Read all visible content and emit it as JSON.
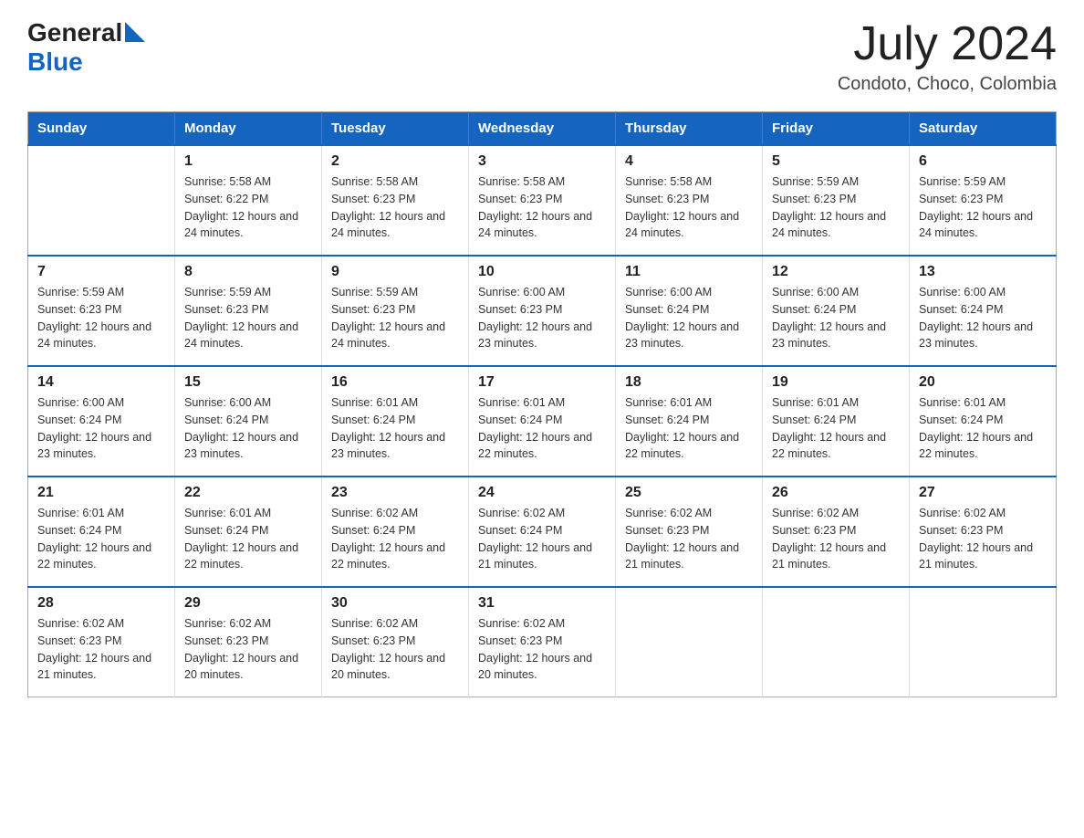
{
  "logo": {
    "text_general": "General",
    "text_blue": "Blue",
    "triangle_char": "▶"
  },
  "title": "July 2024",
  "subtitle": "Condoto, Choco, Colombia",
  "days_of_week": [
    "Sunday",
    "Monday",
    "Tuesday",
    "Wednesday",
    "Thursday",
    "Friday",
    "Saturday"
  ],
  "weeks": [
    [
      {
        "day": "",
        "sunrise": "",
        "sunset": "",
        "daylight": ""
      },
      {
        "day": "1",
        "sunrise": "Sunrise: 5:58 AM",
        "sunset": "Sunset: 6:22 PM",
        "daylight": "Daylight: 12 hours and 24 minutes."
      },
      {
        "day": "2",
        "sunrise": "Sunrise: 5:58 AM",
        "sunset": "Sunset: 6:23 PM",
        "daylight": "Daylight: 12 hours and 24 minutes."
      },
      {
        "day": "3",
        "sunrise": "Sunrise: 5:58 AM",
        "sunset": "Sunset: 6:23 PM",
        "daylight": "Daylight: 12 hours and 24 minutes."
      },
      {
        "day": "4",
        "sunrise": "Sunrise: 5:58 AM",
        "sunset": "Sunset: 6:23 PM",
        "daylight": "Daylight: 12 hours and 24 minutes."
      },
      {
        "day": "5",
        "sunrise": "Sunrise: 5:59 AM",
        "sunset": "Sunset: 6:23 PM",
        "daylight": "Daylight: 12 hours and 24 minutes."
      },
      {
        "day": "6",
        "sunrise": "Sunrise: 5:59 AM",
        "sunset": "Sunset: 6:23 PM",
        "daylight": "Daylight: 12 hours and 24 minutes."
      }
    ],
    [
      {
        "day": "7",
        "sunrise": "Sunrise: 5:59 AM",
        "sunset": "Sunset: 6:23 PM",
        "daylight": "Daylight: 12 hours and 24 minutes."
      },
      {
        "day": "8",
        "sunrise": "Sunrise: 5:59 AM",
        "sunset": "Sunset: 6:23 PM",
        "daylight": "Daylight: 12 hours and 24 minutes."
      },
      {
        "day": "9",
        "sunrise": "Sunrise: 5:59 AM",
        "sunset": "Sunset: 6:23 PM",
        "daylight": "Daylight: 12 hours and 24 minutes."
      },
      {
        "day": "10",
        "sunrise": "Sunrise: 6:00 AM",
        "sunset": "Sunset: 6:23 PM",
        "daylight": "Daylight: 12 hours and 23 minutes."
      },
      {
        "day": "11",
        "sunrise": "Sunrise: 6:00 AM",
        "sunset": "Sunset: 6:24 PM",
        "daylight": "Daylight: 12 hours and 23 minutes."
      },
      {
        "day": "12",
        "sunrise": "Sunrise: 6:00 AM",
        "sunset": "Sunset: 6:24 PM",
        "daylight": "Daylight: 12 hours and 23 minutes."
      },
      {
        "day": "13",
        "sunrise": "Sunrise: 6:00 AM",
        "sunset": "Sunset: 6:24 PM",
        "daylight": "Daylight: 12 hours and 23 minutes."
      }
    ],
    [
      {
        "day": "14",
        "sunrise": "Sunrise: 6:00 AM",
        "sunset": "Sunset: 6:24 PM",
        "daylight": "Daylight: 12 hours and 23 minutes."
      },
      {
        "day": "15",
        "sunrise": "Sunrise: 6:00 AM",
        "sunset": "Sunset: 6:24 PM",
        "daylight": "Daylight: 12 hours and 23 minutes."
      },
      {
        "day": "16",
        "sunrise": "Sunrise: 6:01 AM",
        "sunset": "Sunset: 6:24 PM",
        "daylight": "Daylight: 12 hours and 23 minutes."
      },
      {
        "day": "17",
        "sunrise": "Sunrise: 6:01 AM",
        "sunset": "Sunset: 6:24 PM",
        "daylight": "Daylight: 12 hours and 22 minutes."
      },
      {
        "day": "18",
        "sunrise": "Sunrise: 6:01 AM",
        "sunset": "Sunset: 6:24 PM",
        "daylight": "Daylight: 12 hours and 22 minutes."
      },
      {
        "day": "19",
        "sunrise": "Sunrise: 6:01 AM",
        "sunset": "Sunset: 6:24 PM",
        "daylight": "Daylight: 12 hours and 22 minutes."
      },
      {
        "day": "20",
        "sunrise": "Sunrise: 6:01 AM",
        "sunset": "Sunset: 6:24 PM",
        "daylight": "Daylight: 12 hours and 22 minutes."
      }
    ],
    [
      {
        "day": "21",
        "sunrise": "Sunrise: 6:01 AM",
        "sunset": "Sunset: 6:24 PM",
        "daylight": "Daylight: 12 hours and 22 minutes."
      },
      {
        "day": "22",
        "sunrise": "Sunrise: 6:01 AM",
        "sunset": "Sunset: 6:24 PM",
        "daylight": "Daylight: 12 hours and 22 minutes."
      },
      {
        "day": "23",
        "sunrise": "Sunrise: 6:02 AM",
        "sunset": "Sunset: 6:24 PM",
        "daylight": "Daylight: 12 hours and 22 minutes."
      },
      {
        "day": "24",
        "sunrise": "Sunrise: 6:02 AM",
        "sunset": "Sunset: 6:24 PM",
        "daylight": "Daylight: 12 hours and 21 minutes."
      },
      {
        "day": "25",
        "sunrise": "Sunrise: 6:02 AM",
        "sunset": "Sunset: 6:23 PM",
        "daylight": "Daylight: 12 hours and 21 minutes."
      },
      {
        "day": "26",
        "sunrise": "Sunrise: 6:02 AM",
        "sunset": "Sunset: 6:23 PM",
        "daylight": "Daylight: 12 hours and 21 minutes."
      },
      {
        "day": "27",
        "sunrise": "Sunrise: 6:02 AM",
        "sunset": "Sunset: 6:23 PM",
        "daylight": "Daylight: 12 hours and 21 minutes."
      }
    ],
    [
      {
        "day": "28",
        "sunrise": "Sunrise: 6:02 AM",
        "sunset": "Sunset: 6:23 PM",
        "daylight": "Daylight: 12 hours and 21 minutes."
      },
      {
        "day": "29",
        "sunrise": "Sunrise: 6:02 AM",
        "sunset": "Sunset: 6:23 PM",
        "daylight": "Daylight: 12 hours and 20 minutes."
      },
      {
        "day": "30",
        "sunrise": "Sunrise: 6:02 AM",
        "sunset": "Sunset: 6:23 PM",
        "daylight": "Daylight: 12 hours and 20 minutes."
      },
      {
        "day": "31",
        "sunrise": "Sunrise: 6:02 AM",
        "sunset": "Sunset: 6:23 PM",
        "daylight": "Daylight: 12 hours and 20 minutes."
      },
      {
        "day": "",
        "sunrise": "",
        "sunset": "",
        "daylight": ""
      },
      {
        "day": "",
        "sunrise": "",
        "sunset": "",
        "daylight": ""
      },
      {
        "day": "",
        "sunrise": "",
        "sunset": "",
        "daylight": ""
      }
    ]
  ]
}
